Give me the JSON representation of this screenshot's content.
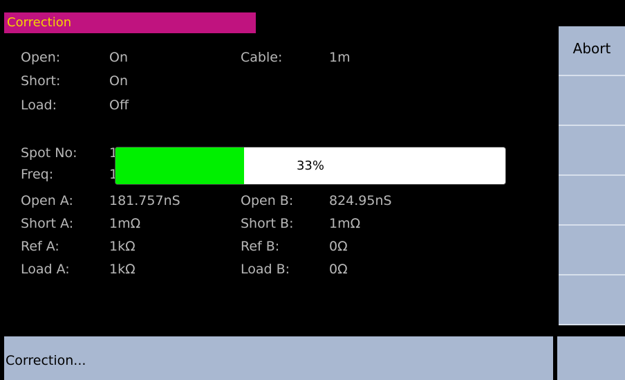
{
  "title": "Correction",
  "fields": {
    "open_label": "Open:",
    "open_value": "On",
    "short_label": "Short:",
    "short_value": "On",
    "load_label": "Load:",
    "load_value": "Off",
    "cable_label": "Cable:",
    "cable_value": "1m",
    "spot_label": "Spot No:",
    "spot_value": "1",
    "freq_label": "Freq:",
    "freq_value": "1",
    "open_a_label": "Open A:",
    "open_a_value": "181.757nS",
    "open_b_label": "Open B:",
    "open_b_value": "824.95nS",
    "short_a_label": "Short A:",
    "short_a_value": "1mΩ",
    "short_b_label": "Short B:",
    "short_b_value": "1mΩ",
    "ref_a_label": "Ref A:",
    "ref_a_value": "1kΩ",
    "ref_b_label": "Ref B:",
    "ref_b_value": "0Ω",
    "load_a_label": "Load A:",
    "load_a_value": "1kΩ",
    "load_b_label": "Load B:",
    "load_b_value": "0Ω"
  },
  "progress": {
    "label": "33%",
    "percent": 33
  },
  "side_buttons": [
    {
      "label": "Abort"
    },
    {
      "label": ""
    },
    {
      "label": ""
    },
    {
      "label": ""
    },
    {
      "label": ""
    },
    {
      "label": ""
    }
  ],
  "status": {
    "text": "Correction..."
  },
  "colors": {
    "title_bg": "#c0137f",
    "title_fg": "#f6d400",
    "progress_fill": "#00f000",
    "panel_bg": "#a9b8d1"
  }
}
